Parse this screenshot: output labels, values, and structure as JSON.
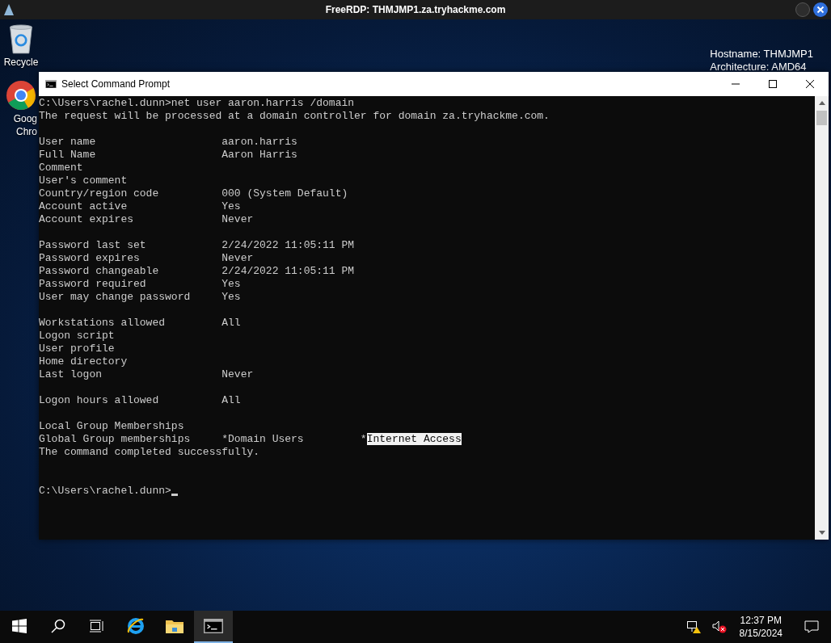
{
  "remote_bar": {
    "title": "FreeRDP: THMJMP1.za.tryhackme.com"
  },
  "desktop": {
    "icons": [
      {
        "kind": "recycle",
        "label_lines": [
          "Recycle"
        ]
      },
      {
        "kind": "chrome",
        "label_lines": [
          "Goog",
          "Chro"
        ]
      }
    ],
    "info": [
      "Hostname: THMJMP1",
      "Architecture: AMD64"
    ]
  },
  "window": {
    "title": "Select Command Prompt",
    "console": {
      "blocks": [
        [
          "C:\\Users\\rachel.dunn>net user aaron.harris /domain",
          "The request will be processed at a domain controller for domain za.tryhackme.com."
        ],
        [
          "User name                    aaron.harris",
          "Full Name                    Aaron Harris",
          "Comment",
          "User's comment",
          "Country/region code          000 (System Default)",
          "Account active               Yes",
          "Account expires              Never"
        ],
        [
          "Password last set            2/24/2022 11:05:11 PM",
          "Password expires             Never",
          "Password changeable          2/24/2022 11:05:11 PM",
          "Password required            Yes",
          "User may change password     Yes"
        ],
        [
          "Workstations allowed         All",
          "Logon script",
          "User profile",
          "Home directory",
          "Last logon                   Never"
        ],
        [
          "Logon hours allowed          All"
        ],
        [
          "Local Group Memberships",
          {
            "segments": [
              {
                "text": "Global Group memberships     *Domain Users         *",
                "selected": false
              },
              {
                "text": "Internet Access",
                "selected": true
              }
            ]
          },
          "The command completed successfully."
        ]
      ],
      "prompt": "C:\\Users\\rachel.dunn>",
      "cursor": true
    }
  },
  "taskbar": {
    "apps": [
      {
        "kind": "ie",
        "selected": false
      },
      {
        "kind": "folder",
        "selected": false
      },
      {
        "kind": "cmd",
        "selected": true
      }
    ],
    "clock": {
      "time": "12:37 PM",
      "date": "8/15/2024"
    }
  }
}
